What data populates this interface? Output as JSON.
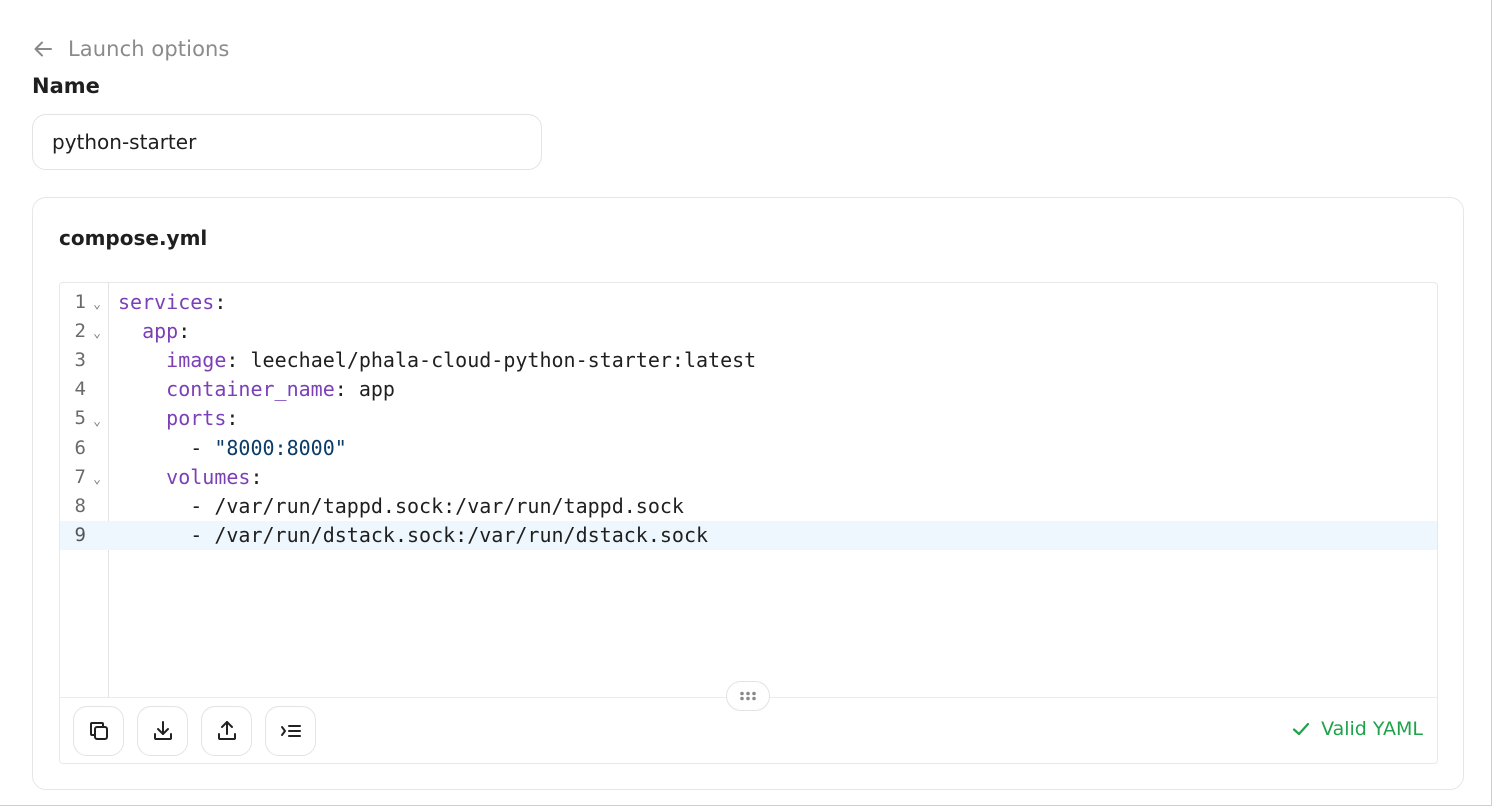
{
  "header": {
    "back_label": "Launch options"
  },
  "form": {
    "name_label": "Name",
    "name_value": "python-starter"
  },
  "editor": {
    "file_title": "compose.yml",
    "active_line": 9,
    "lines": [
      {
        "num": "1",
        "foldable": true,
        "indent": "",
        "key": "services",
        "sep": ":",
        "value": "",
        "value_type": "plain"
      },
      {
        "num": "2",
        "foldable": true,
        "indent": "  ",
        "key": "app",
        "sep": ":",
        "value": "",
        "value_type": "plain"
      },
      {
        "num": "3",
        "foldable": false,
        "indent": "    ",
        "key": "image",
        "sep": ": ",
        "value": "leechael/phala-cloud-python-starter:latest",
        "value_type": "plain"
      },
      {
        "num": "4",
        "foldable": false,
        "indent": "    ",
        "key": "container_name",
        "sep": ": ",
        "value": "app",
        "value_type": "plain"
      },
      {
        "num": "5",
        "foldable": true,
        "indent": "    ",
        "key": "ports",
        "sep": ":",
        "value": "",
        "value_type": "plain"
      },
      {
        "num": "6",
        "foldable": false,
        "indent": "      ",
        "key": "",
        "sep": "- ",
        "value": "\"8000:8000\"",
        "value_type": "string"
      },
      {
        "num": "7",
        "foldable": true,
        "indent": "    ",
        "key": "volumes",
        "sep": ":",
        "value": "",
        "value_type": "plain"
      },
      {
        "num": "8",
        "foldable": false,
        "indent": "      ",
        "key": "",
        "sep": "- ",
        "value": "/var/run/tappd.sock:/var/run/tappd.sock",
        "value_type": "plain"
      },
      {
        "num": "9",
        "foldable": false,
        "indent": "      ",
        "key": "",
        "sep": "- ",
        "value": "/var/run/dstack.sock:/var/run/dstack.sock",
        "value_type": "plain"
      }
    ],
    "toolbar": [
      {
        "name": "copy-button",
        "icon": "copy-icon"
      },
      {
        "name": "download-button",
        "icon": "download-icon"
      },
      {
        "name": "upload-button",
        "icon": "upload-icon"
      },
      {
        "name": "format-button",
        "icon": "format-indent-icon"
      }
    ],
    "status_text": "Valid YAML",
    "status_color": "#1fa34a"
  },
  "colors": {
    "yaml_key": "#7b3fb8",
    "yaml_string": "#0b3b66",
    "active_line_bg": "#eef7fd"
  }
}
